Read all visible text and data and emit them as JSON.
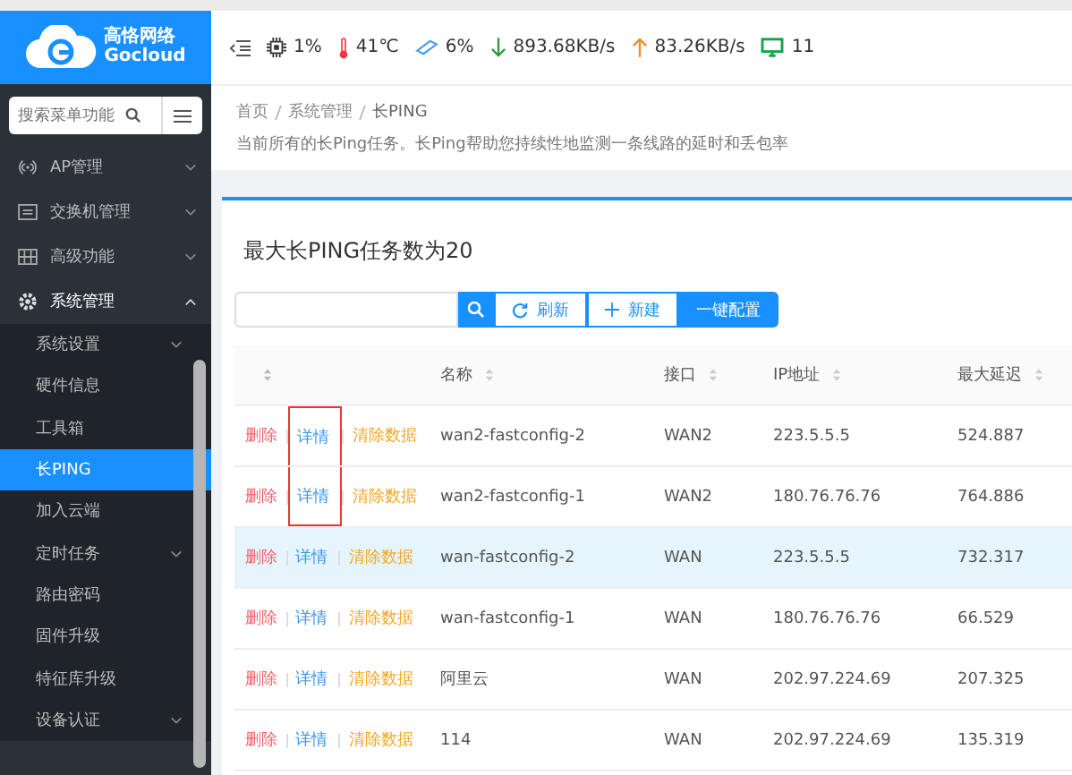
{
  "brand": {
    "name": "高恪网络",
    "subname": "Gocloud"
  },
  "sidebar": {
    "search_placeholder": "搜索菜单功能",
    "items": [
      {
        "label": "AP管理",
        "kind": "antenna",
        "expanded": false,
        "has_children": true
      },
      {
        "label": "交换机管理",
        "kind": "switch",
        "expanded": false,
        "has_children": true
      },
      {
        "label": "高级功能",
        "kind": "grid",
        "expanded": false,
        "has_children": true
      },
      {
        "label": "系统管理",
        "kind": "gear",
        "expanded": true,
        "has_children": true,
        "children": [
          {
            "label": "系统设置",
            "has_children": true,
            "selected": false
          },
          {
            "label": "硬件信息",
            "has_children": false,
            "selected": false
          },
          {
            "label": "工具箱",
            "has_children": false,
            "selected": false
          },
          {
            "label": "长PING",
            "has_children": false,
            "selected": true
          },
          {
            "label": "加入云端",
            "has_children": false,
            "selected": false
          },
          {
            "label": "定时任务",
            "has_children": true,
            "selected": false
          },
          {
            "label": "路由密码",
            "has_children": false,
            "selected": false
          },
          {
            "label": "固件升级",
            "has_children": false,
            "selected": false
          },
          {
            "label": "特征库升级",
            "has_children": false,
            "selected": false
          },
          {
            "label": "设备认证",
            "has_children": true,
            "selected": false
          }
        ]
      }
    ]
  },
  "status": [
    {
      "kind": "cpu",
      "value": "1%"
    },
    {
      "kind": "temp",
      "value": "41℃"
    },
    {
      "kind": "memory",
      "value": "6%"
    },
    {
      "kind": "down",
      "value": "893.68KB/s"
    },
    {
      "kind": "up",
      "value": "83.26KB/s"
    },
    {
      "kind": "clients",
      "value": "11"
    }
  ],
  "breadcrumb": [
    "首页",
    "系统管理",
    "长PING"
  ],
  "description": "当前所有的长Ping任务。长Ping帮助您持续性地监测一条线路的延时和丢包率",
  "card_title": "最大长PING任务数为20",
  "toolbar": {
    "refresh": "刷新",
    "new": "新建",
    "config": "一键配置"
  },
  "table": {
    "columns": [
      "名称",
      "接口",
      "IP地址",
      "最大延迟"
    ],
    "rows": [
      {
        "actions": [
          "删除",
          "详情",
          "清除数据"
        ],
        "name": "wan2-fastconfig-2",
        "iface": "WAN2",
        "ip": "223.5.5.5",
        "delay": "524.887",
        "selected": false,
        "marked": true
      },
      {
        "actions": [
          "删除",
          "详情",
          "清除数据"
        ],
        "name": "wan2-fastconfig-1",
        "iface": "WAN2",
        "ip": "180.76.76.76",
        "delay": "764.886",
        "selected": false,
        "marked": true
      },
      {
        "actions": [
          "删除",
          "详情",
          "清除数据"
        ],
        "name": "wan-fastconfig-2",
        "iface": "WAN",
        "ip": "223.5.5.5",
        "delay": "732.317",
        "selected": true,
        "marked": false
      },
      {
        "actions": [
          "删除",
          "详情",
          "清除数据"
        ],
        "name": "wan-fastconfig-1",
        "iface": "WAN",
        "ip": "180.76.76.76",
        "delay": "66.529",
        "selected": false,
        "marked": false
      },
      {
        "actions": [
          "删除",
          "详情",
          "清除数据"
        ],
        "name": "阿里云",
        "iface": "WAN",
        "ip": "202.97.224.69",
        "delay": "207.325",
        "selected": false,
        "marked": false
      },
      {
        "actions": [
          "删除",
          "详情",
          "清除数据"
        ],
        "name": "114",
        "iface": "WAN",
        "ip": "202.97.224.69",
        "delay": "135.319",
        "selected": false,
        "marked": false
      }
    ]
  }
}
